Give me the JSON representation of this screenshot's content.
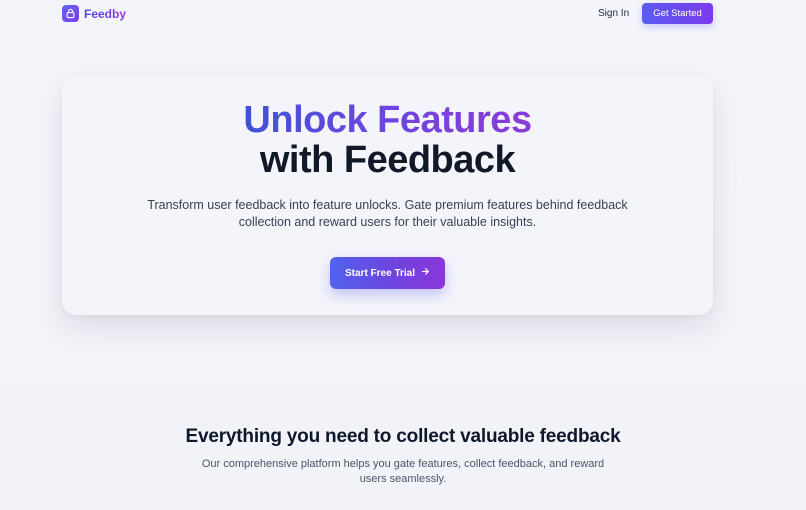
{
  "nav": {
    "brand": "Feedby",
    "brand_icon": "lock-icon",
    "sign_in": "Sign In",
    "get_started": "Get Started"
  },
  "hero": {
    "title_line1": "Unlock Features",
    "title_line2": "with Feedback",
    "subtitle": "Transform user feedback into feature unlocks. Gate premium features behind feedback collection and reward users for their valuable insights.",
    "cta_label": "Start Free Trial",
    "cta_icon": "arrow-right-icon"
  },
  "features": {
    "title": "Everything you need to collect valuable feedback",
    "subtitle": "Our comprehensive platform helps you gate features, collect feedback, and reward users seamlessly."
  },
  "colors": {
    "accent_start": "#5b5cf0",
    "accent_end": "#7c3aed",
    "heading": "#111827"
  }
}
